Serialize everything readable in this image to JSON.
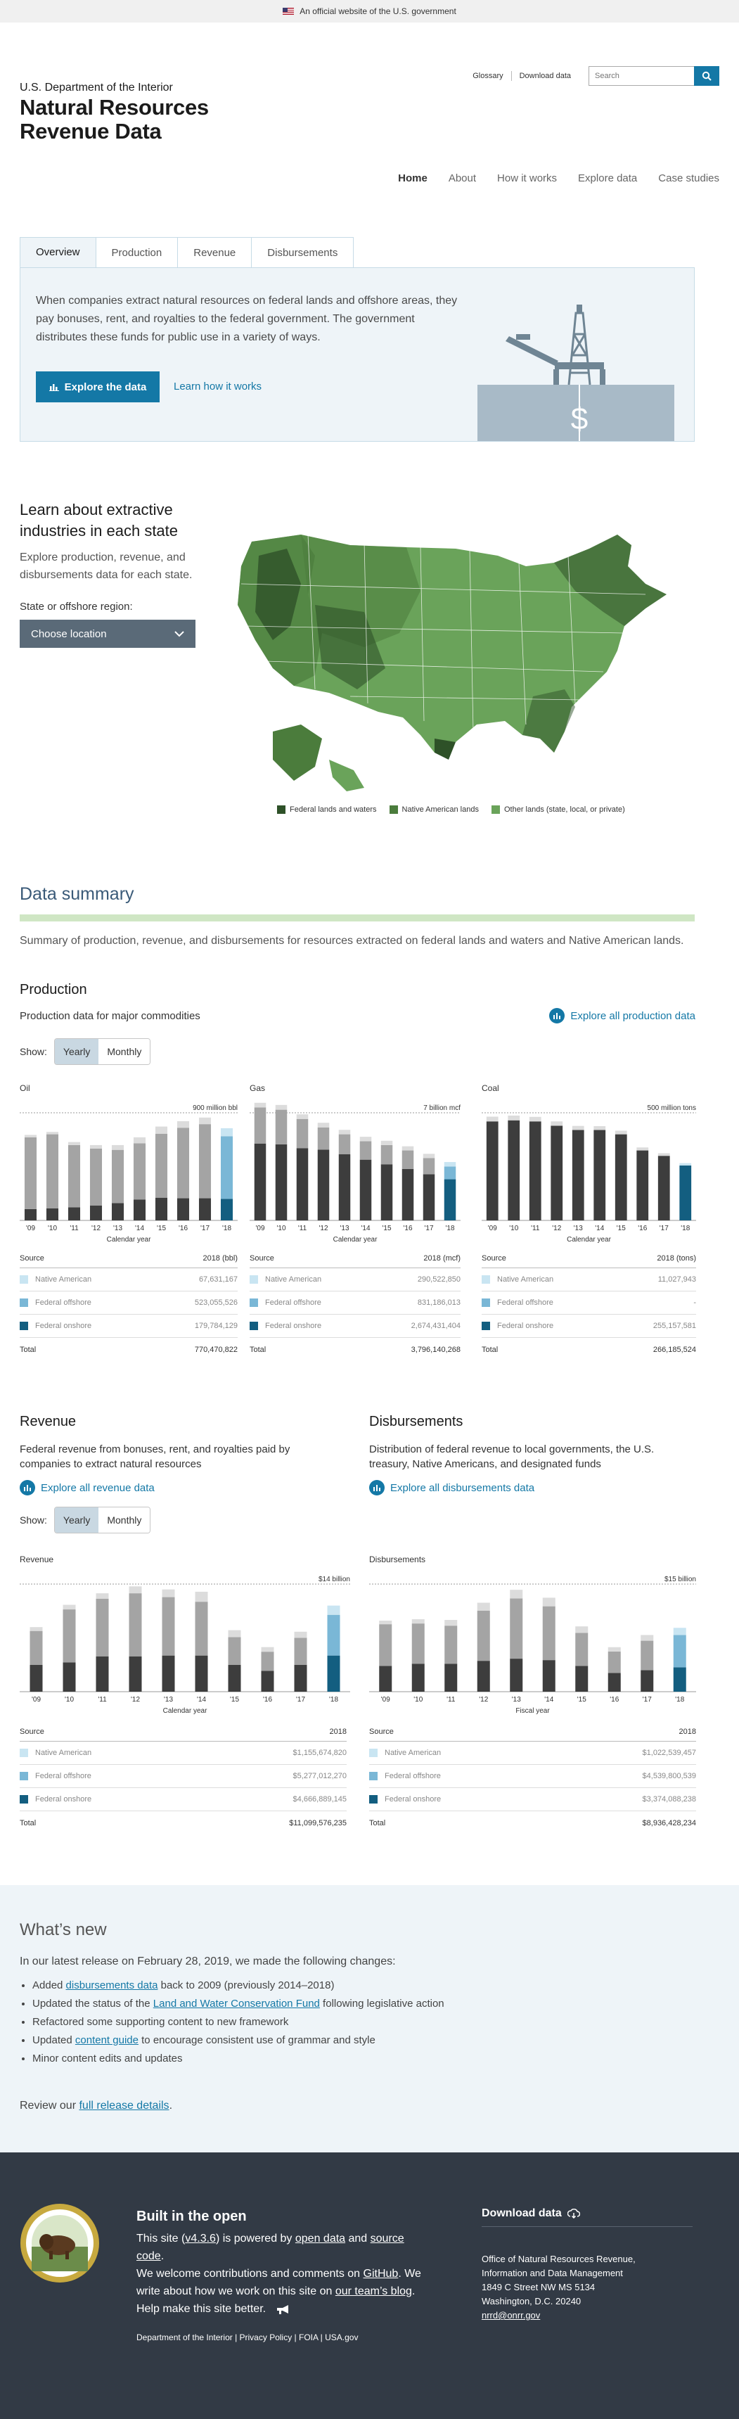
{
  "banner": "An official website of the U.S. government",
  "header": {
    "agency": "U.S. Department of the Interior",
    "title_line1": "Natural Resources",
    "title_line2": "Revenue Data",
    "glossary": "Glossary",
    "download": "Download data",
    "search_placeholder": "Search"
  },
  "nav": [
    "Home",
    "About",
    "How it works",
    "Explore data",
    "Case studies"
  ],
  "tabs": [
    "Overview",
    "Production",
    "Revenue",
    "Disbursements"
  ],
  "hero": {
    "text": "When companies extract natural resources on federal lands and offshore areas, they pay bonuses, rent, and royalties to the federal government. The government distributes these funds for public use in a variety of ways.",
    "button": "Explore the data",
    "link": "Learn how it works"
  },
  "states": {
    "title": "Learn about extractive industries in each state",
    "desc": "Explore production, revenue, and disbursements data for each state.",
    "label": "State or offshore region:",
    "select": "Choose location"
  },
  "map_legend": [
    {
      "label": "Federal lands and waters",
      "color": "#2e5128"
    },
    {
      "label": "Native American lands",
      "color": "#4b7c3c"
    },
    {
      "label": "Other lands (state, local, or private)",
      "color": "#6aa35a"
    }
  ],
  "summary": {
    "title": "Data summary",
    "desc": "Summary of production, revenue, and disbursements for resources extracted on federal lands and waters and Native American lands."
  },
  "production": {
    "title": "Production",
    "desc": "Production data for major commodities",
    "explore": "Explore all production data",
    "show": "Show:",
    "toggle": [
      "Yearly",
      "Monthly"
    ]
  },
  "chart_data": [
    {
      "type": "bar",
      "title": "Oil",
      "max_label": "900 million bbl",
      "xlabel": "Calendar year",
      "categories": [
        "'09",
        "'10",
        "'11",
        "'12",
        "'13",
        "'14",
        "'15",
        "'16",
        "'17",
        "'18"
      ],
      "ylim": [
        0,
        900
      ],
      "series": [
        {
          "name": "Federal onshore",
          "values": [
            95,
            100,
            110,
            125,
            145,
            175,
            190,
            185,
            185,
            180
          ]
        },
        {
          "name": "Federal offshore",
          "values": [
            600,
            620,
            520,
            475,
            445,
            470,
            535,
            590,
            620,
            523
          ]
        },
        {
          "name": "Native American",
          "values": [
            20,
            20,
            25,
            30,
            40,
            50,
            60,
            55,
            55,
            68
          ]
        }
      ],
      "table": {
        "header": [
          "Source",
          "2018 (bbl)"
        ],
        "rows": [
          [
            "Native American",
            "67,631,167"
          ],
          [
            "Federal offshore",
            "523,055,526"
          ],
          [
            "Federal onshore",
            "179,784,129"
          ]
        ],
        "total": [
          "Total",
          "770,470,822"
        ]
      }
    },
    {
      "type": "bar",
      "title": "Gas",
      "max_label": "7 billion mcf",
      "xlabel": "Calendar year",
      "categories": [
        "'09",
        "'10",
        "'11",
        "'12",
        "'13",
        "'14",
        "'15",
        "'16",
        "'17",
        "'18"
      ],
      "ylim": [
        0,
        7000
      ],
      "series": [
        {
          "name": "Federal onshore",
          "values": [
            5000,
            4950,
            4700,
            4600,
            4300,
            3950,
            3650,
            3350,
            3000,
            2674
          ]
        },
        {
          "name": "Federal offshore",
          "values": [
            2350,
            2250,
            1900,
            1450,
            1300,
            1200,
            1250,
            1200,
            1050,
            831
          ]
        },
        {
          "name": "Native American",
          "values": [
            300,
            310,
            300,
            300,
            290,
            290,
            280,
            270,
            280,
            291
          ]
        }
      ],
      "table": {
        "header": [
          "Source",
          "2018 (mcf)"
        ],
        "rows": [
          [
            "Native American",
            "290,522,850"
          ],
          [
            "Federal offshore",
            "831,186,013"
          ],
          [
            "Federal onshore",
            "2,674,431,404"
          ]
        ],
        "total": [
          "Total",
          "3,796,140,268"
        ]
      }
    },
    {
      "type": "bar",
      "title": "Coal",
      "max_label": "500 million tons",
      "xlabel": "Calendar year",
      "categories": [
        "'09",
        "'10",
        "'11",
        "'12",
        "'13",
        "'14",
        "'15",
        "'16",
        "'17",
        "'18"
      ],
      "ylim": [
        0,
        500
      ],
      "series": [
        {
          "name": "Federal onshore",
          "values": [
            460,
            465,
            460,
            440,
            420,
            420,
            400,
            325,
            300,
            255
          ]
        },
        {
          "name": "Federal offshore",
          "values": [
            0,
            0,
            0,
            0,
            0,
            0,
            0,
            0,
            0,
            0
          ]
        },
        {
          "name": "Native American",
          "values": [
            22,
            22,
            21,
            20,
            19,
            18,
            17,
            14,
            12,
            11
          ]
        }
      ],
      "table": {
        "header": [
          "Source",
          "2018 (tons)"
        ],
        "rows": [
          [
            "Native American",
            "11,027,943"
          ],
          [
            "Federal offshore",
            "-"
          ],
          [
            "Federal onshore",
            "255,157,581"
          ]
        ],
        "total": [
          "Total",
          "266,185,524"
        ]
      }
    },
    {
      "type": "bar",
      "title": "Revenue",
      "max_label": "$14 billion",
      "xlabel": "Calendar year",
      "categories": [
        "'09",
        "'10",
        "'11",
        "'12",
        "'13",
        "'14",
        "'15",
        "'16",
        "'17",
        "'18"
      ],
      "ylim": [
        0,
        14
      ],
      "series": [
        {
          "name": "Federal onshore",
          "values": [
            3.5,
            3.8,
            4.6,
            4.6,
            4.7,
            4.7,
            3.5,
            2.7,
            3.5,
            4.7
          ]
        },
        {
          "name": "Federal offshore",
          "values": [
            4.4,
            6.9,
            7.5,
            8.2,
            7.6,
            7.0,
            3.6,
            2.5,
            3.5,
            5.3
          ]
        },
        {
          "name": "Native American",
          "values": [
            0.5,
            0.6,
            0.7,
            0.9,
            1.0,
            1.3,
            0.9,
            0.6,
            0.8,
            1.2
          ]
        }
      ],
      "table": {
        "header": [
          "Source",
          "2018"
        ],
        "rows": [
          [
            "Native American",
            "$1,155,674,820"
          ],
          [
            "Federal offshore",
            "$5,277,012,270"
          ],
          [
            "Federal onshore",
            "$4,666,889,145"
          ]
        ],
        "total": [
          "Total",
          "$11,099,576,235"
        ]
      }
    },
    {
      "type": "bar",
      "title": "Disbursements",
      "max_label": "$15 billion",
      "xlabel": "Fiscal year",
      "categories": [
        "'09",
        "'10",
        "'11",
        "'12",
        "'13",
        "'14",
        "'15",
        "'16",
        "'17",
        "'18"
      ],
      "ylim": [
        0,
        15
      ],
      "series": [
        {
          "name": "Federal onshore",
          "values": [
            3.6,
            3.9,
            3.9,
            4.3,
            4.6,
            4.4,
            3.6,
            2.6,
            3.0,
            3.4
          ]
        },
        {
          "name": "Federal offshore",
          "values": [
            5.8,
            5.6,
            5.3,
            7.0,
            8.4,
            7.5,
            4.6,
            3.0,
            4.1,
            4.5
          ]
        },
        {
          "name": "Native American",
          "values": [
            0.5,
            0.6,
            0.8,
            1.1,
            1.2,
            1.2,
            0.9,
            0.6,
            0.8,
            1.0
          ]
        }
      ],
      "table": {
        "header": [
          "Source",
          "2018"
        ],
        "rows": [
          [
            "Native American",
            "$1,022,539,457"
          ],
          [
            "Federal offshore",
            "$4,539,800,539"
          ],
          [
            "Federal onshore",
            "$3,374,088,238"
          ]
        ],
        "total": [
          "Total",
          "$8,936,428,234"
        ]
      }
    }
  ],
  "series_colors": {
    "Federal onshore": "#135e80",
    "Federal offshore": "#7ab7d6",
    "Native American": "#c9e5f2",
    "gray_onshore": "#3d3d3d",
    "gray_offshore": "#a4a4a4",
    "gray_native": "#dcdcdc"
  },
  "revenue": {
    "title": "Revenue",
    "desc": "Federal revenue from bonuses, rent, and royalties paid by companies to extract natural resources",
    "explore": "Explore all revenue data",
    "show": "Show:",
    "toggle": [
      "Yearly",
      "Monthly"
    ]
  },
  "disbursements": {
    "title": "Disbursements",
    "desc": "Distribution of federal revenue to local governments, the U.S. treasury, Native Americans, and designated funds",
    "explore": "Explore all disbursements data"
  },
  "whatsnew": {
    "title": "What’s new",
    "intro": "In our latest release on February 28, 2019, we made the following changes:",
    "items": [
      [
        "Added ",
        "disbursements data",
        " back to 2009 (previously 2014–2018)"
      ],
      [
        "Updated the status of the ",
        "Land and Water Conservation Fund",
        " following legislative action"
      ],
      [
        "Refactored some supporting content to new framework",
        "",
        ""
      ],
      [
        "Updated ",
        "content guide",
        " to encourage consistent use of grammar and style"
      ],
      [
        "Minor content edits and updates",
        "",
        ""
      ]
    ],
    "review_pre": "Review our ",
    "review_link": "full release details",
    "review_post": "."
  },
  "footer": {
    "title": "Built in the open",
    "l1a": "This site (",
    "version": "v4.3.6",
    "l1b": ") is powered by ",
    "open_data": "open data",
    "and": " and ",
    "source_code": "source code",
    "l1c": ".",
    "l2a": "We welcome contributions and comments on ",
    "github": "GitHub",
    "l2b": ". We",
    "l3a": "write about how we work on this site on ",
    "blog": "our team’s blog",
    "l3b": ".",
    "help": "Help make this site better.",
    "download": "Download data",
    "addr": [
      "Office of Natural Resources Revenue,",
      "Information and Data Management",
      "1849 C Street NW MS 5134",
      "Washington, D.C. 20240"
    ],
    "email": "nrrd@onrr.gov",
    "links": "Department of the Interior | Privacy Policy | FOIA | USA.gov"
  }
}
